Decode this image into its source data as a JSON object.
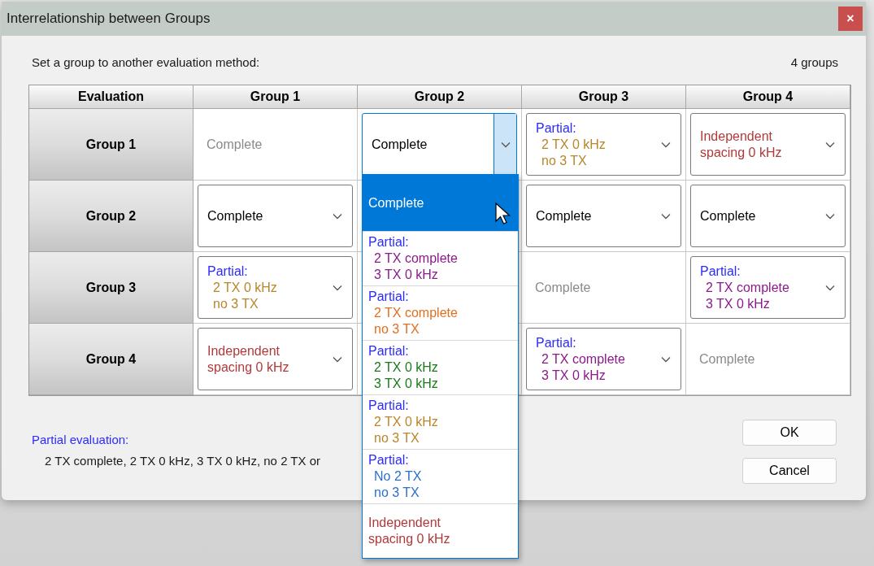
{
  "window": {
    "title": "Interrelationship between Groups",
    "close": "×"
  },
  "instruction": "Set a group to another evaluation method:",
  "group_count": "4 groups",
  "table": {
    "columns": [
      "Evaluation",
      "Group 1",
      "Group 2",
      "Group 3",
      "Group 4"
    ],
    "rows": [
      {
        "label": "Group 1",
        "cells": [
          {
            "kind": "fixed",
            "lines": [
              "Complete"
            ],
            "color": "#8a8a8a"
          },
          {
            "kind": "dropdown",
            "lines": [
              "Complete"
            ],
            "color": "#000000",
            "open": true
          },
          {
            "kind": "dropdown",
            "heading": "Partial:",
            "lines": [
              "2 TX 0 kHz",
              "no 3 TX"
            ],
            "color": "#b8862b",
            "open": false
          },
          {
            "kind": "dropdown",
            "lines": [
              "Independent",
              "spacing 0 kHz"
            ],
            "color": "#b03a3a",
            "open": false
          }
        ]
      },
      {
        "label": "Group 2",
        "cells": [
          {
            "kind": "dropdown",
            "lines": [
              "Complete"
            ],
            "color": "#000000",
            "open": false
          },
          {
            "kind": "hidden"
          },
          {
            "kind": "dropdown",
            "lines": [
              "Complete"
            ],
            "color": "#000000",
            "open": false
          },
          {
            "kind": "dropdown",
            "lines": [
              "Complete"
            ],
            "color": "#000000",
            "open": false
          }
        ]
      },
      {
        "label": "Group 3",
        "cells": [
          {
            "kind": "dropdown",
            "heading": "Partial:",
            "lines": [
              "2 TX 0 kHz",
              "no 3 TX"
            ],
            "color": "#b8862b",
            "open": false
          },
          {
            "kind": "hidden"
          },
          {
            "kind": "fixed",
            "lines": [
              "Complete"
            ],
            "color": "#8a8a8a"
          },
          {
            "kind": "dropdown",
            "heading": "Partial:",
            "lines": [
              "2 TX complete",
              "3 TX 0 kHz"
            ],
            "color": "#8b1a8b",
            "open": false
          }
        ]
      },
      {
        "label": "Group 4",
        "cells": [
          {
            "kind": "dropdown",
            "lines": [
              "Independent",
              "spacing 0 kHz"
            ],
            "color": "#b03a3a",
            "open": false
          },
          {
            "kind": "hidden"
          },
          {
            "kind": "dropdown",
            "heading": "Partial:",
            "lines": [
              "2 TX complete",
              "3 TX 0 kHz"
            ],
            "color": "#8b1a8b",
            "open": false
          },
          {
            "kind": "fixed",
            "lines": [
              "Complete"
            ],
            "color": "#8a8a8a"
          }
        ]
      }
    ]
  },
  "dropdown_options": [
    {
      "lines": [
        "Complete"
      ],
      "color": "#ffffff",
      "selected": true
    },
    {
      "heading": "Partial:",
      "lines": [
        "2 TX complete",
        "3 TX 0 kHz"
      ],
      "color": "#8b1a8b",
      "selected": false
    },
    {
      "heading": "Partial:",
      "lines": [
        "2 TX complete",
        "no 3 TX"
      ],
      "color": "#e07020",
      "selected": false
    },
    {
      "heading": "Partial:",
      "lines": [
        "2 TX 0 kHz",
        "3 TX 0 kHz"
      ],
      "color": "#1a7a1a",
      "selected": false
    },
    {
      "heading": "Partial:",
      "lines": [
        "2 TX 0 kHz",
        "no 3 TX"
      ],
      "color": "#b8862b",
      "selected": false
    },
    {
      "heading": "Partial:",
      "lines": [
        "No 2 TX",
        "no 3 TX"
      ],
      "color": "#2a6fd0",
      "selected": false
    },
    {
      "lines": [
        "Independent",
        "spacing 0 kHz"
      ],
      "color": "#b03a3a",
      "selected": false
    }
  ],
  "legend": {
    "title": "Partial evaluation:",
    "text": "2 TX complete, 2 TX 0 kHz, 3 TX 0 kHz, no 2 TX or"
  },
  "buttons": [
    "OK",
    "Cancel"
  ]
}
